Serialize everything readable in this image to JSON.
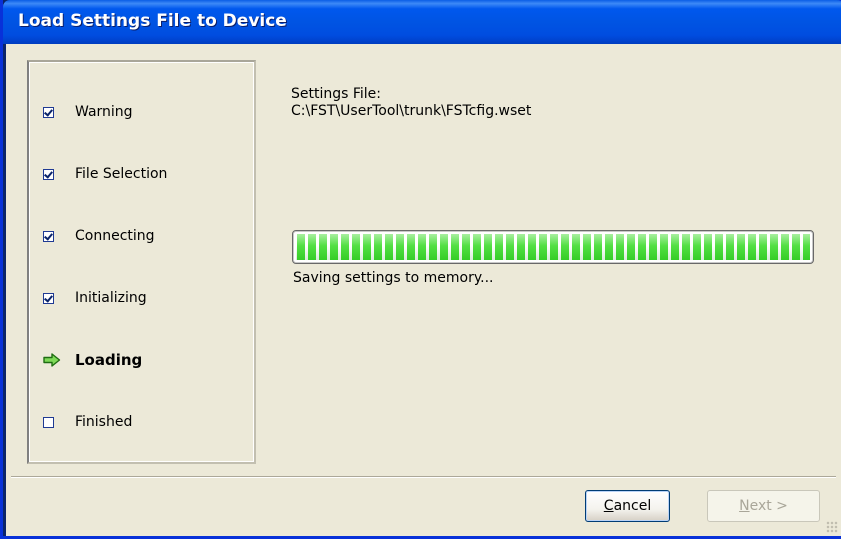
{
  "window": {
    "title": "Load Settings File to Device"
  },
  "steps": [
    {
      "label": "Warning",
      "state": "done",
      "icon": "checkbox-checked-icon"
    },
    {
      "label": "File Selection",
      "state": "done",
      "icon": "checkbox-checked-icon"
    },
    {
      "label": "Connecting",
      "state": "done",
      "icon": "checkbox-checked-icon"
    },
    {
      "label": "Initializing",
      "state": "done",
      "icon": "checkbox-checked-icon"
    },
    {
      "label": "Loading",
      "state": "active",
      "icon": "arrow-right-icon"
    },
    {
      "label": "Finished",
      "state": "pending",
      "icon": "checkbox-empty-icon"
    }
  ],
  "main": {
    "settings_label": "Settings File:",
    "settings_path": "C:\\FST\\UserTool\\trunk\\FSTcfig.wset",
    "progress_fraction": 1.0,
    "status": "Saving settings to memory..."
  },
  "buttons": {
    "cancel_prefix": "C",
    "cancel_rest": "ancel",
    "next_prefix": "N",
    "next_rest": "ext >"
  },
  "colors": {
    "titlebar": "#0054e3",
    "progress_green": "#3fdc2e",
    "arrow_green": "#2f9e1f",
    "face": "#ece9d8"
  }
}
